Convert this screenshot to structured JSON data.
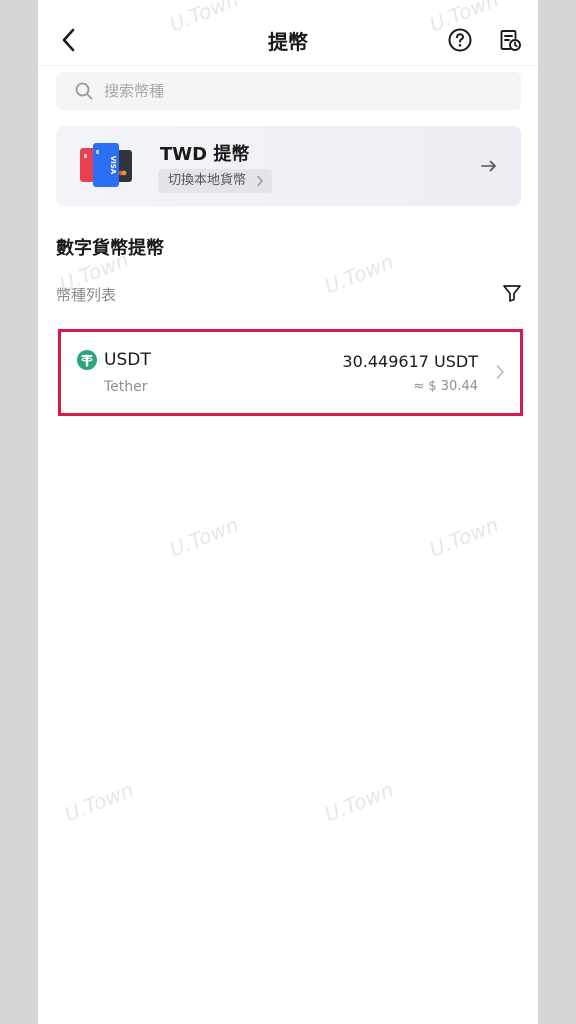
{
  "header": {
    "title": "提幣",
    "back_icon": "chevron-left-icon",
    "help_icon": "question-circle-icon",
    "history_icon": "document-clock-icon"
  },
  "search": {
    "placeholder": "搜索幣種"
  },
  "fiat_card": {
    "title": "TWD 提幣",
    "switch_label": "切換本地貨幣",
    "icon": "payment-cards-icon"
  },
  "section": {
    "title": "數字貨幣提幣",
    "list_label": "幣種列表"
  },
  "coins": [
    {
      "symbol": "USDT",
      "name": "Tether",
      "amount": "30.449617 USDT",
      "fiat_value": "≈ $ 30.44",
      "logo_letter": "T"
    }
  ],
  "watermark": "U.Town",
  "colors": {
    "highlight_border": "#d9184a",
    "usdt_green": "#2aa57d",
    "card_bg": "#f3f4f7"
  }
}
